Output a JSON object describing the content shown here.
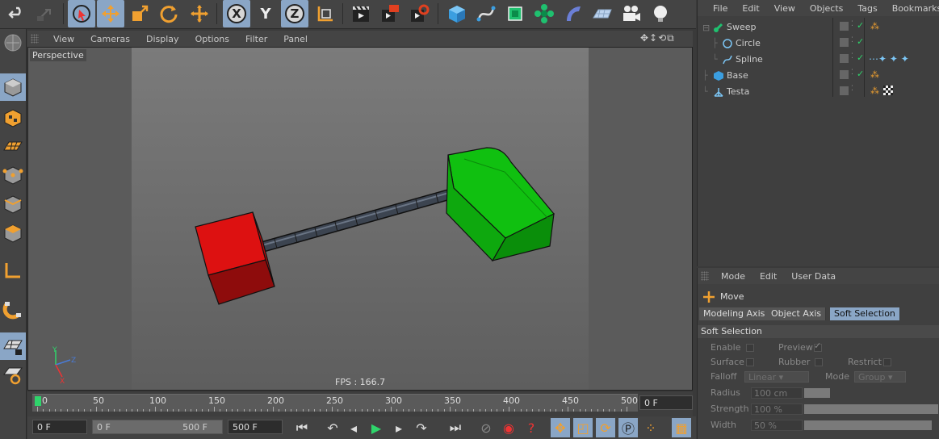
{
  "viewport": {
    "menu": [
      "View",
      "Cameras",
      "Display",
      "Options",
      "Filter",
      "Panel"
    ],
    "camera_label": "Perspective",
    "fps_label": "FPS : 166.7",
    "axis_labels": {
      "x": "X",
      "y": "Y",
      "z": "Z"
    },
    "nav_icons": "✥↕⟲⧉"
  },
  "toolbar": {
    "axis_x": "X",
    "axis_y": "Y",
    "axis_z": "Z",
    "icons": [
      "undo-icon",
      "redo-icon",
      "live-selection-icon",
      "move-icon",
      "scale-icon",
      "rotate-icon",
      "move-alt-icon",
      "lock-x-icon",
      "lock-y-icon",
      "lock-z-icon",
      "coordinate-system-icon",
      "render-view-icon",
      "render-picture-viewer-icon",
      "render-settings-icon",
      "cube-icon",
      "spline-icon",
      "nurbs-icon",
      "array-icon",
      "deformer-icon",
      "floor-icon",
      "camera-icon",
      "light-icon"
    ]
  },
  "left_toolbar": {
    "icons": [
      "make-editable-icon",
      "model-mode-icon",
      "texture-mode-icon",
      "workplane-icon",
      "points-mode-icon",
      "edges-mode-icon",
      "polygons-mode-icon",
      "axis-mode-icon",
      "snapping-icon",
      "enable-snap-icon",
      "locked-workplane-icon",
      "planar-icon"
    ]
  },
  "timeline": {
    "ticks": [
      "0",
      "50",
      "100",
      "150",
      "200",
      "250",
      "300",
      "350",
      "400",
      "450",
      "500"
    ],
    "current_frame_field": "0 F",
    "start_field": "0 F",
    "range_start": "0 F",
    "range_end": "500 F",
    "end_field": "500 F"
  },
  "object_manager": {
    "menu": [
      "File",
      "Edit",
      "View",
      "Objects",
      "Tags",
      "Bookmarks"
    ],
    "objects": [
      {
        "name": "Sweep",
        "indent": 0,
        "icon": "sweep-icon"
      },
      {
        "name": "Circle",
        "indent": 1,
        "icon": "circle-spline-icon"
      },
      {
        "name": "Spline",
        "indent": 1,
        "icon": "spline-object-icon"
      },
      {
        "name": "Base",
        "indent": 0,
        "icon": "cube-object-icon"
      },
      {
        "name": "Testa",
        "indent": 0,
        "icon": "null-object-icon"
      }
    ]
  },
  "attribute_manager": {
    "menu": [
      "Mode",
      "Edit",
      "User Data"
    ],
    "tool_name": "Move",
    "tabs": [
      "Modeling Axis",
      "Object Axis",
      "Soft Selection"
    ],
    "active_tab": "Soft Selection",
    "section_title": "Soft Selection",
    "enable_label": "Enable",
    "preview_label": "Preview",
    "surface_label": "Surface",
    "rubber_label": "Rubber",
    "restrict_label": "Restrict",
    "falloff_label": "Falloff",
    "falloff_value": "Linear",
    "mode_label": "Mode",
    "mode_value": "Group",
    "radius_label": "Radius",
    "radius_value": "100 cm",
    "strength_label": "Strength",
    "strength_value": "100 %",
    "width_label": "Width",
    "width_value": "50 %"
  },
  "colors": {
    "accent": "#8aa6c6",
    "base_cube": "#cc1111",
    "head_block": "#10b810",
    "playhead": "#2fd46b"
  }
}
